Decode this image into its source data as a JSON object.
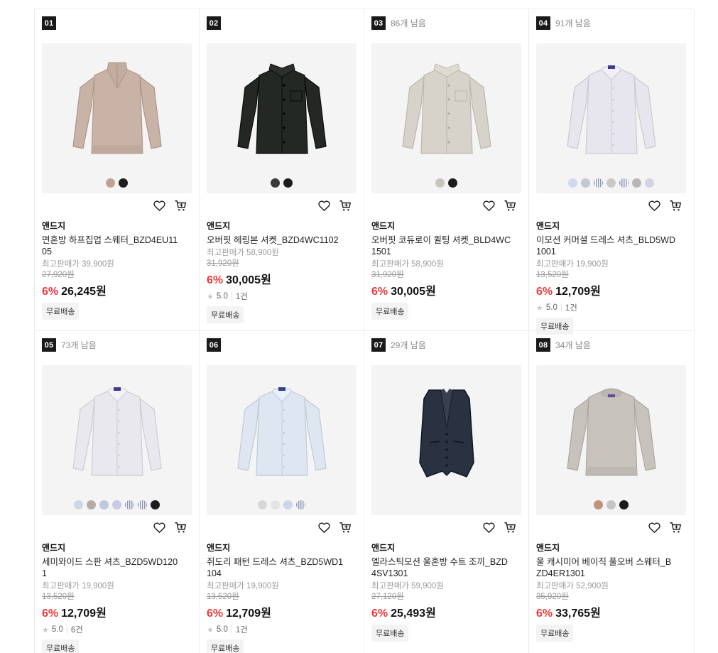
{
  "products": [
    {
      "rank": "01",
      "stock": "",
      "brand": "앤드지",
      "name": "면혼방 하프집업 스웨터_BZD4EU1105",
      "max_price": "최고판매가 39,900원",
      "original_price": "27,920원",
      "discount": "6%",
      "price": "26,245원",
      "rating": "",
      "reviews": "",
      "shipping": "무료배송",
      "garment": "sweater-zip",
      "garment_color": "#c9b3a6",
      "swatches": [
        "#bfa493",
        "#1c1c1c"
      ]
    },
    {
      "rank": "02",
      "stock": "",
      "brand": "앤드지",
      "name": "오버핏 헤링본 셔켓_BZD4WC1102",
      "max_price": "최고판매가 58,900원",
      "original_price": "31,920원",
      "discount": "6%",
      "price": "30,005원",
      "rating": "5.0",
      "reviews": "1건",
      "shipping": "무료배송",
      "garment": "jacket",
      "garment_color": "#242824",
      "swatches": [
        "#3a3a3a",
        "#1c1c1c"
      ]
    },
    {
      "rank": "03",
      "stock": "86개 남음",
      "brand": "앤드지",
      "name": "오버핏 코듀로이 퀼팅 셔켓_BLD4WC1501",
      "max_price": "최고판매가 58,900원",
      "original_price": "31,920원",
      "discount": "6%",
      "price": "30,005원",
      "rating": "",
      "reviews": "",
      "shipping": "무료배송",
      "garment": "jacket",
      "garment_color": "#d8d3ca",
      "swatches": [
        "#c9c5bd",
        "#1c1c1c"
      ]
    },
    {
      "rank": "04",
      "stock": "91개 남음",
      "brand": "앤드지",
      "name": "이모션 커머셜 드레스 셔츠_BLD5WD1001",
      "max_price": "최고판매가 19,900원",
      "original_price": "13,520원",
      "discount": "6%",
      "price": "12,709원",
      "rating": "5.0",
      "reviews": "1건",
      "shipping": "무료배송",
      "garment": "shirt",
      "garment_color": "#e7e6ee",
      "swatches": [
        "#d3d8ee",
        "#c3c8d4",
        "stripe",
        "#c9c9c9",
        "stripe",
        "#b7b7b7",
        "#d1d4e2"
      ]
    },
    {
      "rank": "05",
      "stock": "73개 남음",
      "brand": "앤드지",
      "name": "세미와이드 스판 셔츠_BZD5WD1201",
      "max_price": "최고판매가 19,900원",
      "original_price": "13,520원",
      "discount": "6%",
      "price": "12,709원",
      "rating": "5.0",
      "reviews": "6건",
      "shipping": "무료배송",
      "garment": "shirt",
      "garment_color": "#e9e8ef",
      "swatches": [
        "#cfd8e2",
        "#b7a9a8",
        "#c0c8dc",
        "#c7cbe3",
        "stripe",
        "stripe",
        "#1c1c1c"
      ]
    },
    {
      "rank": "06",
      "stock": "",
      "brand": "앤드지",
      "name": "쥐도리 패턴 드레스 셔츠_BZD5WD1104",
      "max_price": "최고판매가 19,900원",
      "original_price": "13,520원",
      "discount": "6%",
      "price": "12,709원",
      "rating": "5.0",
      "reviews": "1건",
      "shipping": "무료배송",
      "garment": "shirt",
      "garment_color": "#dde6f1",
      "swatches": [
        "#d8d8d8",
        "#e4e4e4",
        "#c9d5e8",
        "stripe"
      ]
    },
    {
      "rank": "07",
      "stock": "29개 남음",
      "brand": "앤드지",
      "name": "엘라스틱모션 울혼방 수트 조끼_BZD4SV1301",
      "max_price": "최고판매가 59,900원",
      "original_price": "27,120원",
      "discount": "6%",
      "price": "25,493원",
      "rating": "",
      "reviews": "",
      "shipping": "무료배송",
      "garment": "vest",
      "garment_color": "#2a3140",
      "swatches": []
    },
    {
      "rank": "08",
      "stock": "34개 남음",
      "brand": "앤드지",
      "name": "울 캐시미어 베이직 풀오버 스웨터_BZD4ER1301",
      "max_price": "최고판매가 52,900원",
      "original_price": "35,920원",
      "discount": "6%",
      "price": "33,765원",
      "rating": "",
      "reviews": "",
      "shipping": "무료배송",
      "garment": "sweater",
      "garment_color": "#c8c2bd",
      "swatches": [
        "#c09479",
        "#c4c4c4",
        "#1c1c1c"
      ]
    }
  ],
  "colors": {
    "discount": "#f0393b",
    "rank_badge": "#1a1a1a",
    "thumb_bg": "#f4f4f4"
  },
  "icons": {
    "wish": "heart-icon",
    "cart": "cart-icon",
    "rating": "star-icon"
  }
}
